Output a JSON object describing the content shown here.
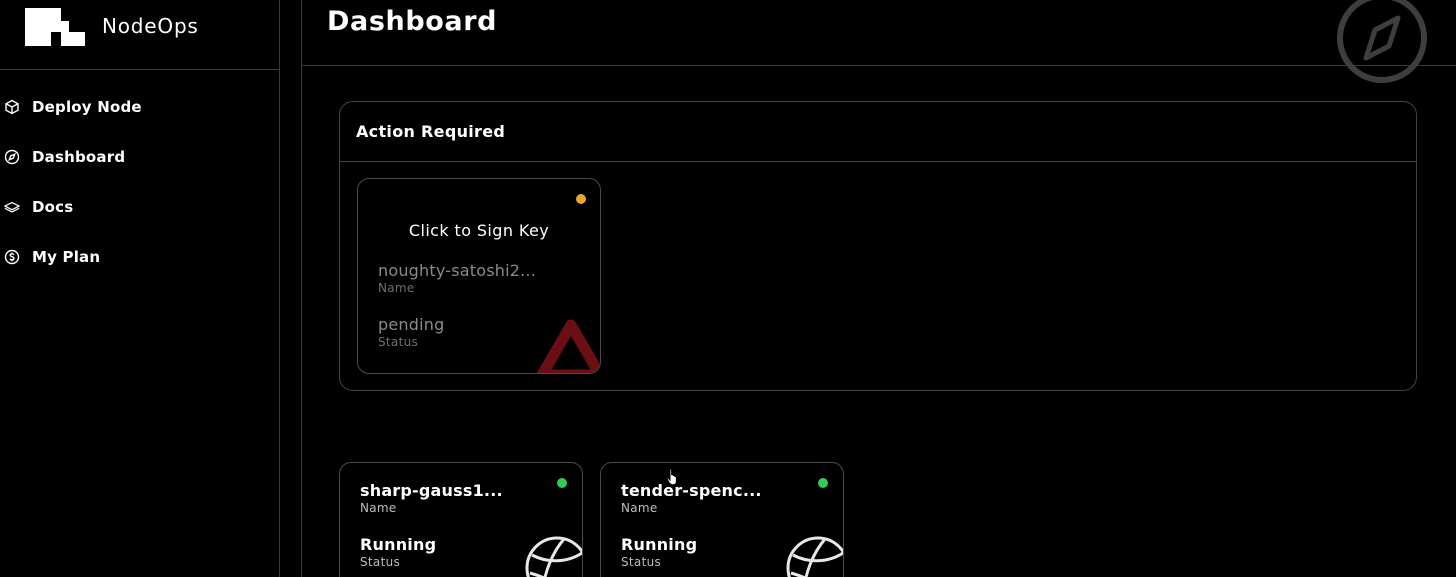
{
  "brand": {
    "name": "NodeOps"
  },
  "sidebar": {
    "items": [
      {
        "label": "Deploy Node",
        "icon": "cube-icon"
      },
      {
        "label": "Dashboard",
        "icon": "compass-icon"
      },
      {
        "label": "Docs",
        "icon": "book-icon"
      },
      {
        "label": "My Plan",
        "icon": "dollar-circle-icon"
      }
    ]
  },
  "header": {
    "title": "Dashboard",
    "icon": "compass-icon"
  },
  "action_required": {
    "title": "Action Required",
    "card": {
      "cta": "Click to Sign Key",
      "name_value": "noughty-satoshi2...",
      "name_label": "Name",
      "status_value": "pending",
      "status_label": "Status",
      "status_color": "#e6a52a",
      "icon": "warning-triangle-icon",
      "icon_color": "#6b0f14"
    }
  },
  "nodes": [
    {
      "name": "sharp-gauss1...",
      "name_label": "Name",
      "status": "Running",
      "status_label": "Status",
      "status_color": "#2ecc55",
      "icon": "globe-icon"
    },
    {
      "name": "tender-spenc...",
      "name_label": "Name",
      "status": "Running",
      "status_label": "Status",
      "status_color": "#2ecc55",
      "icon": "globe-icon"
    }
  ],
  "colors": {
    "background": "#000000",
    "border": "#3a3a3a",
    "text": "#ffffff"
  }
}
